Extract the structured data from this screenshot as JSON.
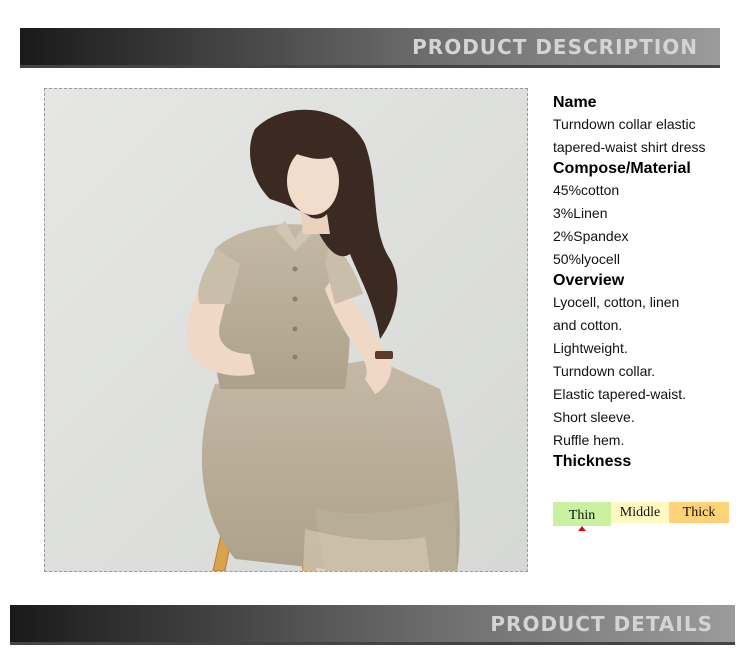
{
  "banners": {
    "top_title": "PRODUCT DESCRIPTION",
    "bottom_title": "PRODUCT DETAILS"
  },
  "product": {
    "name_heading": "Name",
    "name_lines": [
      "Turndown collar elastic",
      "tapered-waist shirt dress"
    ],
    "material_heading": "Compose/Material",
    "material_lines": [
      "45%cotton",
      "3%Linen",
      "2%Spandex",
      "50%lyocell"
    ],
    "overview_heading": "Overview",
    "overview_lines": [
      "Lyocell, cotton, linen",
      "and cotton.",
      "Lightweight.",
      "Turndown collar.",
      "Elastic tapered-waist.",
      "Short sleeve.",
      "Ruffle hem."
    ],
    "thickness_heading": "Thickness",
    "thickness_options": [
      "Thin",
      "Middle",
      "Thick"
    ],
    "thickness_selected": "Thin"
  },
  "colors": {
    "thin": "#c8f2a0",
    "middle": "#fff8c0",
    "thick": "#ffd27a",
    "indicator": "#d01010"
  }
}
